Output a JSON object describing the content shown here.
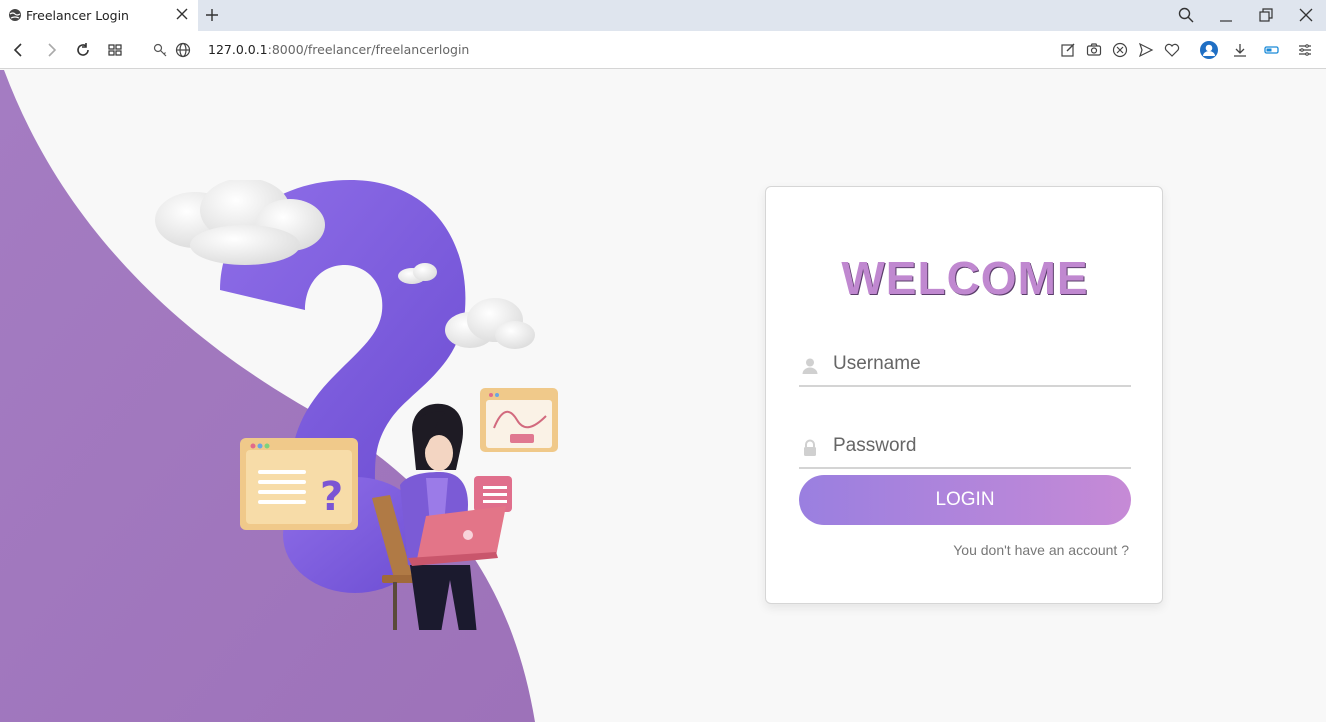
{
  "browser": {
    "tab_title": "Freelancer Login",
    "url_host": "127.0.0.1",
    "url_path": ":8000/freelancer/freelancerlogin"
  },
  "login_card": {
    "heading": "WELCOME",
    "username_placeholder": "Username",
    "password_placeholder": "Password",
    "login_label": "LOGIN",
    "signup_link": "You don't have an account ?"
  },
  "colors": {
    "accent": "#c088d0",
    "button_start": "#9a7fe0",
    "button_end": "#c68ad6",
    "wave": "#a37abf"
  }
}
